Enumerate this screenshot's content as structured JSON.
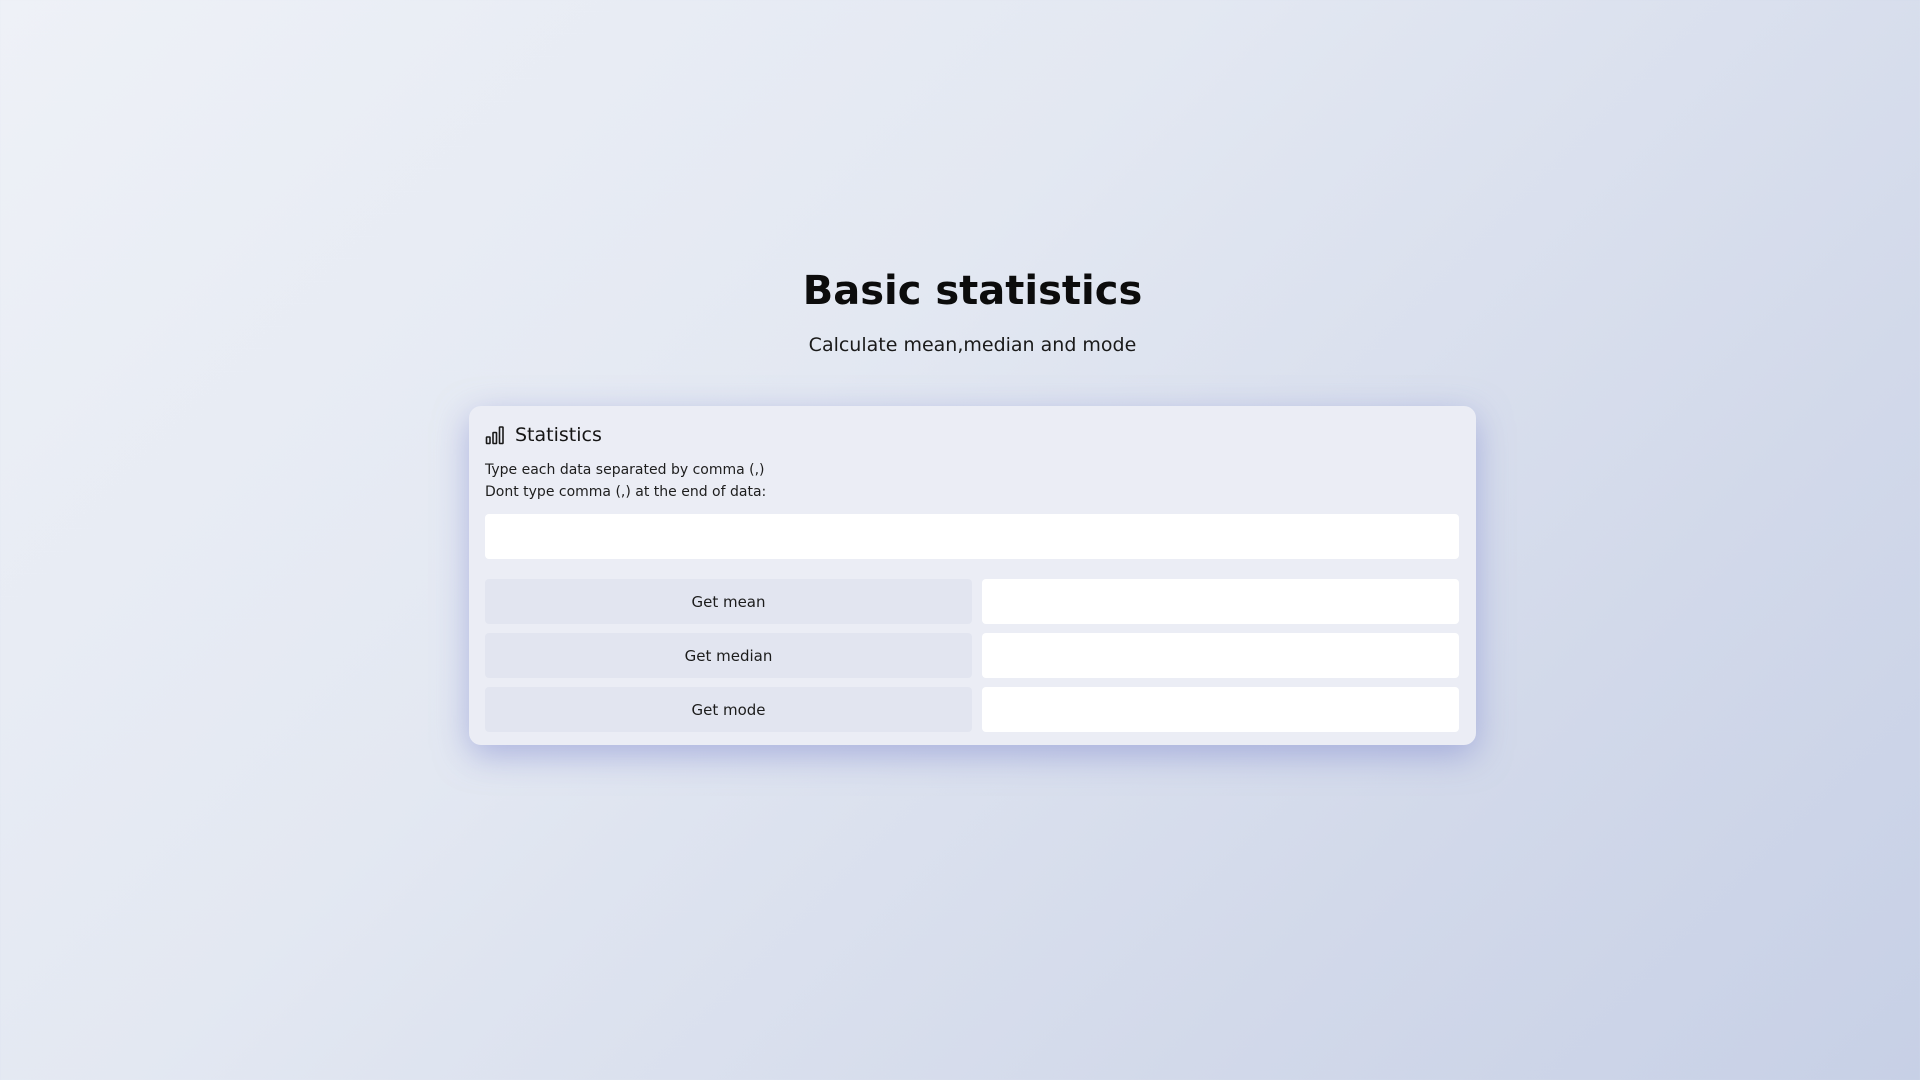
{
  "header": {
    "title": "Basic statistics",
    "subtitle": "Calculate mean,median and mode"
  },
  "card": {
    "icon": "bar-chart-icon",
    "title": "Statistics",
    "instruction_line1": "Type each data separated by comma (,)",
    "instruction_line2": "Dont type comma (,) at the end of data:",
    "data_input_value": "",
    "rows": [
      {
        "button_label": "Get mean",
        "result_value": ""
      },
      {
        "button_label": "Get median",
        "result_value": ""
      },
      {
        "button_label": "Get mode",
        "result_value": ""
      }
    ]
  },
  "colors": {
    "card_background": "#ebedf5",
    "button_background": "#e2e5f0",
    "input_background": "#ffffff",
    "shadow_accent": "#7d87cd"
  }
}
